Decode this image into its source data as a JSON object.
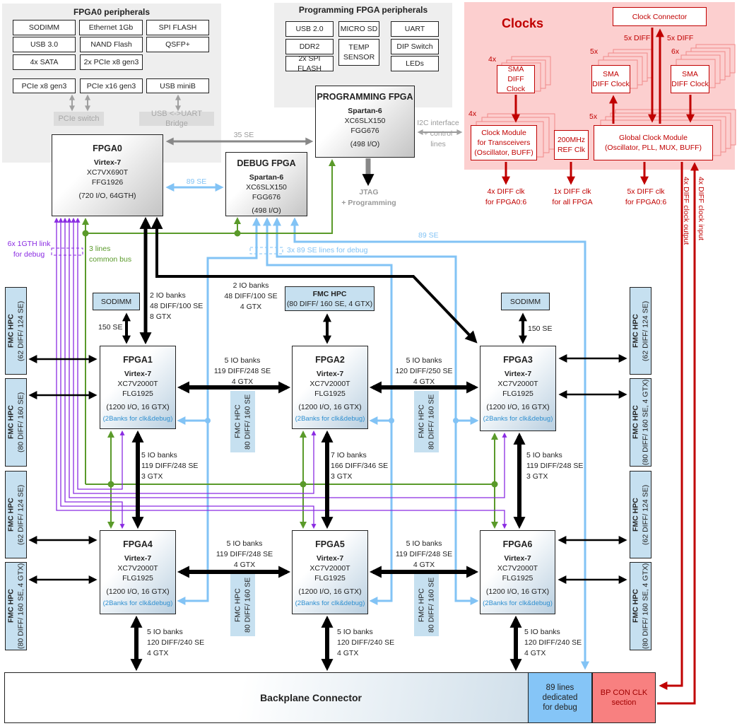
{
  "panels": {
    "fpga0_peripherals": "FPGA0 peripherals",
    "prog_peripherals": "Programming FPGA peripherals",
    "clocks": "Clocks"
  },
  "boxes": {
    "p0_sodimm": [
      "SODIMM"
    ],
    "p0_eth": [
      "Ethernet 1Gb"
    ],
    "p0_spi": [
      "SPI FLASH"
    ],
    "p0_usb3": [
      "USB 3.0"
    ],
    "p0_nand": [
      "NAND Flash"
    ],
    "p0_qsfp": [
      "QSFP+"
    ],
    "p0_sata": [
      "4x SATA"
    ],
    "p0_pcie2x8": [
      "2x PCIe x8 gen3"
    ],
    "p0_pciex8": [
      "PCIe x8 gen3"
    ],
    "p0_pciex16": [
      "PCIe x16 gen3"
    ],
    "p0_usbmini": [
      "USB miniB"
    ],
    "br_pcie": [
      "PCIe switch"
    ],
    "br_usb": [
      "USB <->UART Bridge"
    ],
    "pp_usb2": [
      "USB 2.0"
    ],
    "pp_sd": [
      "MICRO SD"
    ],
    "pp_uart": [
      "UART"
    ],
    "pp_ddr2": [
      "DDR2"
    ],
    "pp_temp": [
      "TEMP",
      "SENSOR"
    ],
    "pp_dip": [
      "DIP Switch"
    ],
    "pp_spi": [
      "2x SPI FLASH"
    ],
    "pp_leds": [
      "LEDs"
    ],
    "sodimm1": [
      "SODIMM"
    ],
    "sodimm3": [
      "SODIMM"
    ],
    "fmc_top": [
      "FMC HPC",
      "(80 DIFF/ 160 SE, 4 GTX)"
    ],
    "fmc_l1": [
      "FMC HPC",
      "(62 DIFF/ 124 SE)"
    ],
    "fmc_l2": [
      "FMC HPC",
      "(80 DIFF/ 160 SE)"
    ],
    "fmc_l3": [
      "FMC HPC",
      "(62 DIFF/ 124 SE)"
    ],
    "fmc_l4": [
      "FMC HPC",
      "(80 DIFF/ 160 SE, 4 GTX)"
    ],
    "fmc_r1": [
      "FMC HPC",
      "(62 DIFF/ 124 SE)"
    ],
    "fmc_r2": [
      "FMC HPC",
      "(80 DIFF/ 160 SE, 4 GTX)"
    ],
    "fmc_r3": [
      "FMC HPC",
      "(62 DIFF/ 124 SE)"
    ],
    "fmc_r4": [
      "FMC HPC",
      "(80 DIFF/ 160 SE, 4 GTX)"
    ],
    "fmc_m1": [
      "FMC HPC",
      "80 DIFF/ 160 SE"
    ],
    "fmc_m2": [
      "FMC HPC",
      "80 DIFF/ 160 SE"
    ],
    "fmc_m3": [
      "FMC HPC",
      "80 DIFF/ 160 SE"
    ],
    "fmc_m4": [
      "FMC HPC",
      "80 DIFF/ 160 SE"
    ],
    "clk_connector": [
      "Clock Connector"
    ],
    "sma_left": [
      "SMA",
      "DIFF Clock"
    ],
    "sma_mid": [
      "SMA",
      "DIFF Clock"
    ],
    "sma_right": [
      "SMA",
      "DIFF Clock"
    ],
    "clk_trx": [
      "Clock Module",
      "for Transceivers",
      "(Oscillator, BUFF)"
    ],
    "ref200": [
      "200MHz",
      "REF Clk"
    ],
    "gcm": [
      "Global Clock Module",
      "(Oscillator, PLL, MUX, BUFF)"
    ],
    "backplane": [
      "Backplane Connector"
    ],
    "bp_debug": [
      "89  lines",
      "dedicated",
      "for debug"
    ],
    "bp_clk": [
      "BP CON CLK",
      "section"
    ]
  },
  "fpgas": {
    "fpga0": {
      "title": "FPGA0",
      "family": "Virtex-7",
      "part": "XC7VX690T",
      "package": "FFG1926",
      "io": "(720 I/O, 64GTH)"
    },
    "prog": {
      "title": "PROGRAMMING FPGA",
      "family": "Spartan-6",
      "part": "XC6SLX150",
      "package": "FGG676",
      "io": "(498 I/O)"
    },
    "debug": {
      "title": "DEBUG FPGA",
      "family": "Spartan-6",
      "part": "XC6SLX150",
      "package": "FGG676",
      "io": "(498 I/O)"
    },
    "fpga1": {
      "title": "FPGA1",
      "family": "Virtex-7",
      "part": "XC7V2000T",
      "package": "FLG1925",
      "io": "(1200 I/O, 16 GTX)",
      "note": "(2Banks for clk&debug)"
    },
    "fpga2": {
      "title": "FPGA2",
      "family": "Virtex-7",
      "part": "XC7V2000T",
      "package": "FLG1925",
      "io": "(1200 I/O, 16 GTX)",
      "note": "(2Banks for clk&debug)"
    },
    "fpga3": {
      "title": "FPGA3",
      "family": "Virtex-7",
      "part": "XC7V2000T",
      "package": "FLG1925",
      "io": "(1200 I/O, 16 GTX)",
      "note": "(2Banks for clk&debug)"
    },
    "fpga4": {
      "title": "FPGA4",
      "family": "Virtex-7",
      "part": "XC7V2000T",
      "package": "FLG1925",
      "io": "(1200 I/O, 16 GTX)",
      "note": "(2Banks for clk&debug)"
    },
    "fpga5": {
      "title": "FPGA5",
      "family": "Virtex-7",
      "part": "XC7V2000T",
      "package": "FLG1925",
      "io": "(1200 I/O, 16 GTX)",
      "note": "(2Banks for clk&debug)"
    },
    "fpga6": {
      "title": "FPGA6",
      "family": "Virtex-7",
      "part": "XC7V2000T",
      "package": "FLG1925",
      "io": "(1200 I/O, 16 GTX)",
      "note": "(2Banks for clk&debug)"
    }
  },
  "labels": {
    "se35": [
      "35 SE"
    ],
    "se89_dbg": [
      "89 SE"
    ],
    "i2c": [
      "I2C interface",
      "+ control",
      "lines"
    ],
    "jtag": [
      "JTAG",
      "+ Programming"
    ],
    "gth": [
      "6x 1GTH link",
      "for debug"
    ],
    "bus": [
      "3 lines",
      "common bus"
    ],
    "dbg3": [
      "3x 89 SE lines for debug"
    ],
    "se89": [
      "89 SE"
    ],
    "f0_f1": [
      "2 IO banks",
      "48 DIFF/100 SE",
      "8 GTX"
    ],
    "f0_f3": [
      "2 IO banks",
      "48 DIFF/100 SE",
      "4 GTX"
    ],
    "sod1": [
      "150 SE"
    ],
    "sod3": [
      "150 SE"
    ],
    "f1_f2": [
      "5 IO banks",
      "119 DIFF/248 SE",
      "4 GTX"
    ],
    "f2_f3": [
      "5 IO banks",
      "120 DIFF/250 SE",
      "4 GTX"
    ],
    "f1_f4": [
      "5 IO banks",
      "119 DIFF/248 SE",
      "3 GTX"
    ],
    "f2_f5": [
      "7 IO banks",
      "166 DIFF/346 SE",
      "3 GTX"
    ],
    "f3_f6": [
      "5 IO banks",
      "119 DIFF/248 SE",
      "3 GTX"
    ],
    "f4_f5": [
      "5 IO banks",
      "119 DIFF/248 SE",
      "4 GTX"
    ],
    "f5_f6": [
      "5 IO banks",
      "119 DIFF/248 SE",
      "4 GTX"
    ],
    "f4_bp": [
      "5 IO banks",
      "120 DIFF/240 SE",
      "4 GTX"
    ],
    "f5_bp": [
      "5 IO banks",
      "120 DIFF/240 SE",
      "4 GTX"
    ],
    "f6_bp": [
      "5 IO banks",
      "120 DIFF/240 SE",
      "4 GTX"
    ],
    "n4a": [
      "4x"
    ],
    "n4b": [
      "4x"
    ],
    "n5a": [
      "5x"
    ],
    "n5b": [
      "5x"
    ],
    "n6": [
      "6x"
    ],
    "diff_dn": [
      "5x DIFF"
    ],
    "diff_up": [
      "5x DIFF"
    ],
    "clk_trx_out": [
      "4x DIFF clk",
      "for FPGA0:6"
    ],
    "ref_out": [
      "1x DIFF clk",
      "for all FPGA"
    ],
    "gcm_out": [
      "5x DIFF clk",
      "for FPGA0:6"
    ],
    "clk_out_v": [
      "4x DIFF clock output"
    ],
    "clk_in_v": [
      "4x DIFF clock input"
    ]
  },
  "colors": {
    "panel_gray": "#eeeeee",
    "clock_panel": "#fccfcf",
    "clock_red": "#c00000",
    "debug_blue": "#82c3f5",
    "common_bus_green": "#5a9a2a",
    "gth_purple": "#8a2be2",
    "peripheral_link_gray": "#999999",
    "fpga_link_black": "#000000"
  }
}
